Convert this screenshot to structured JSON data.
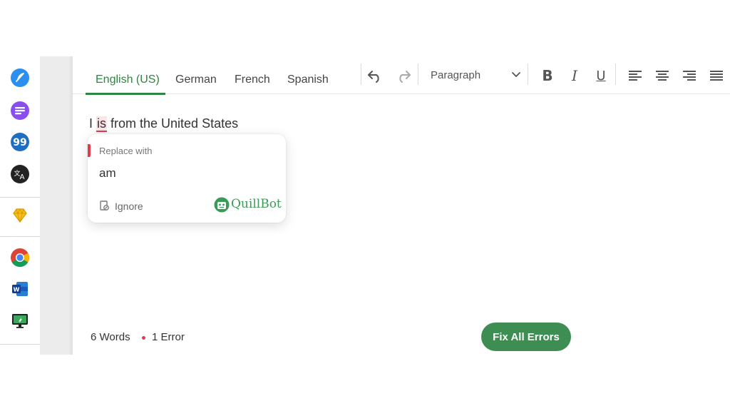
{
  "languages": {
    "tabs": [
      "English (US)",
      "German",
      "French",
      "Spanish"
    ],
    "active": "English (US)"
  },
  "toolbar": {
    "paragraph_style": "Paragraph"
  },
  "document": {
    "before": "I ",
    "error_word": "is",
    "after": " from the United States"
  },
  "suggestion": {
    "title": "Replace with",
    "replacement": "am",
    "ignore_label": "Ignore",
    "brand": "QuillBot"
  },
  "footer": {
    "word_count": "6 Words",
    "error_count": "1 Error",
    "fix_button": "Fix All Errors"
  },
  "colors": {
    "accent": "#2e8540",
    "error": "#e03a4e",
    "button": "#3e8e53"
  }
}
